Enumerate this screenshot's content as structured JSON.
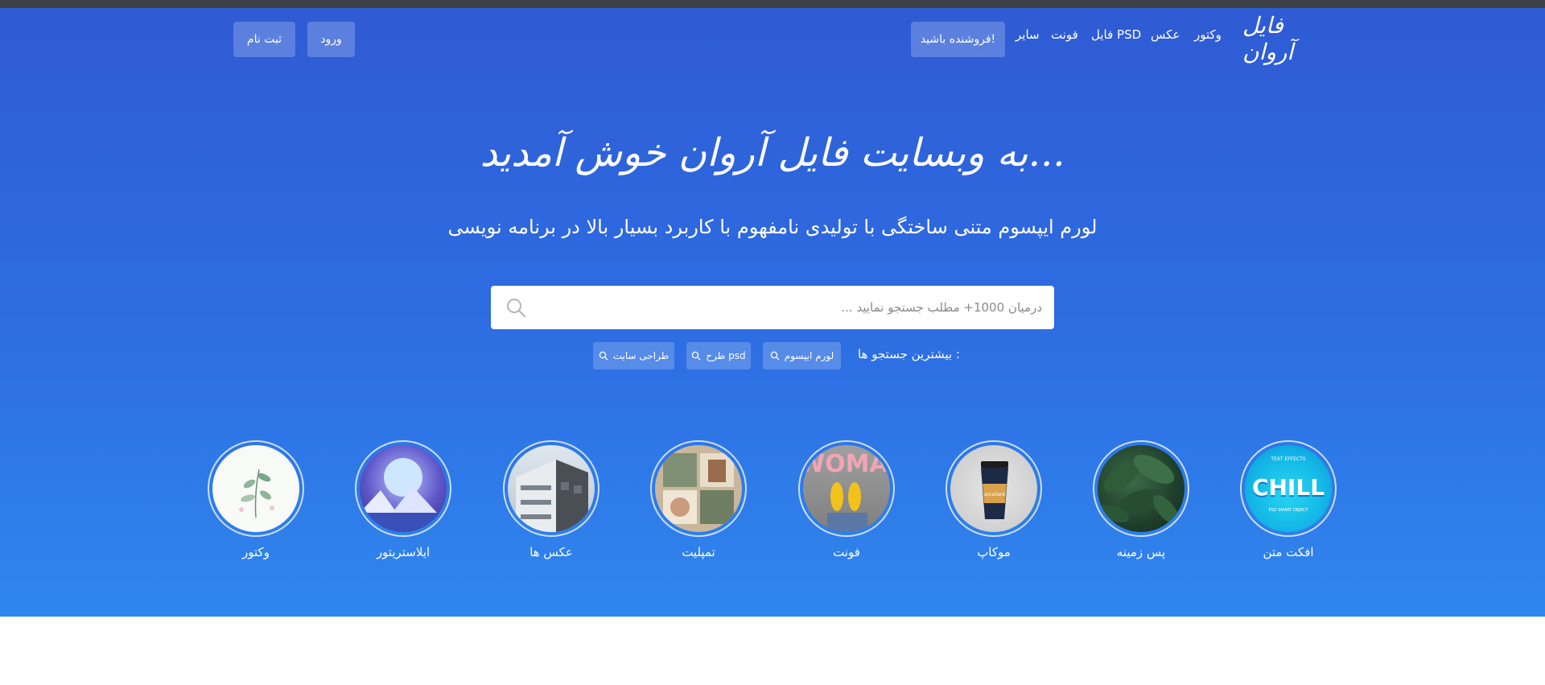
{
  "header": {
    "logo_text": "فایل آروان",
    "nav": {
      "vector": "وکتور",
      "photo": "عکس",
      "psd": "فایل PSD",
      "font": "فونت",
      "other": "سایر"
    },
    "seller_button": "فروشنده باشید!",
    "login_button": "ورود",
    "register_button": "ثبت نام"
  },
  "hero": {
    "welcome": "به وبسایت فایل آروان خوش آمدید...",
    "subtitle": "لورم ایپسوم متنی ساختگی با تولیدی نامفهوم با کاربرد بسیار بالا در برنامه نویسی"
  },
  "search": {
    "placeholder": "درمیان 1000+ مطلب جستجو نمایید ...",
    "value": ""
  },
  "popular": {
    "label": "بیشترین جستجو ها :",
    "chips": [
      "لورم ایپسوم",
      "طرح psd",
      "طراحی سایت"
    ]
  },
  "categories": [
    {
      "label": "افکت متن",
      "image_top_text": "TEXT EFFECTS",
      "image_main_text": "CHILL",
      "image_bottom_text": "PSD SMART OBJECT"
    },
    {
      "label": "پس زمینه"
    },
    {
      "label": "موکاپ",
      "image_text": "arcaliare"
    },
    {
      "label": "فونت",
      "image_text": "WOMAN"
    },
    {
      "label": "تمپلیت"
    },
    {
      "label": "عکس ها"
    },
    {
      "label": "ایلاستریتور"
    },
    {
      "label": "وکتور"
    }
  ],
  "colors": {
    "hero_top": "#2f5bd4",
    "hero_bottom": "#2f86ee",
    "top_strip": "#3b3f48"
  }
}
